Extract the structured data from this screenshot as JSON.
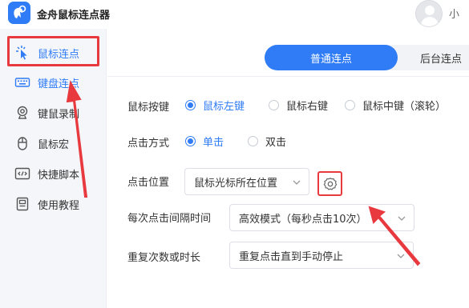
{
  "app": {
    "title": "金舟鼠标连点器",
    "user_text": "小"
  },
  "sidebar": {
    "items": [
      {
        "label": "鼠标连点",
        "icon": "mouse-click-icon"
      },
      {
        "label": "键盘连点",
        "icon": "keyboard-icon"
      },
      {
        "label": "键鼠录制",
        "icon": "record-icon"
      },
      {
        "label": "鼠标宏",
        "icon": "mouse-icon"
      },
      {
        "label": "快捷脚本",
        "icon": "code-icon"
      },
      {
        "label": "使用教程",
        "icon": "tutorial-icon"
      }
    ]
  },
  "tabs": {
    "active": "普通连点",
    "inactive": "后台连点"
  },
  "form": {
    "mouse_button": {
      "label": "鼠标按键",
      "options": [
        "鼠标左键",
        "鼠标右键",
        "鼠标中键（滚轮）"
      ],
      "selected": "鼠标左键"
    },
    "click_mode": {
      "label": "点击方式",
      "options": [
        "单击",
        "双击"
      ],
      "selected": "单击"
    },
    "click_position": {
      "label": "点击位置",
      "value": "鼠标光标所在位置"
    },
    "interval": {
      "label": "每次点击间隔时间",
      "value": "高效模式（每秒点击10次）"
    },
    "repeat": {
      "label": "重复次数或时长",
      "value": "重复点击直到手动停止"
    }
  },
  "colors": {
    "accent": "#2f7cf6",
    "annotation_red": "#e8393f",
    "sidebar_bg": "#f4f6fa"
  }
}
